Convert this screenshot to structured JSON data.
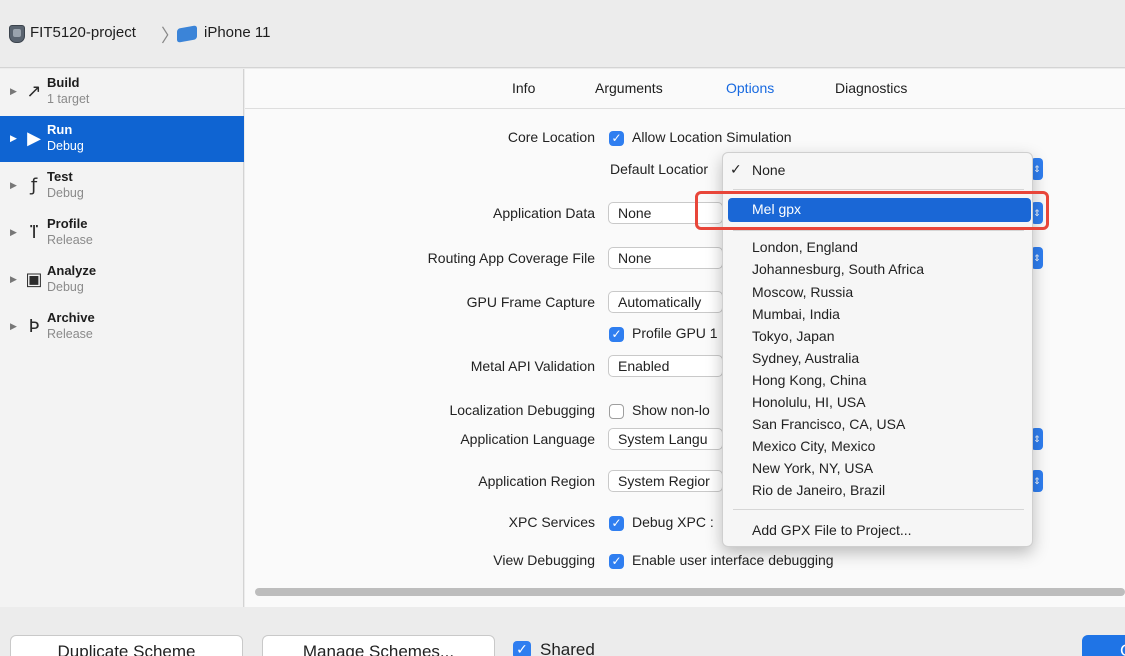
{
  "breadcrumb": {
    "project": "FIT5120-project",
    "separator": "〉",
    "device": "iPhone 11"
  },
  "sidebar": {
    "items": [
      {
        "name": "Build",
        "sub": "1 target",
        "icon": "hammer-icon",
        "glyph": "↗"
      },
      {
        "name": "Run",
        "sub": "Debug",
        "icon": "play-icon",
        "glyph": "▶"
      },
      {
        "name": "Test",
        "sub": "Debug",
        "icon": "wrench-icon",
        "glyph": "ƒ"
      },
      {
        "name": "Profile",
        "sub": "Release",
        "icon": "instruments-icon",
        "glyph": "ⴶ"
      },
      {
        "name": "Analyze",
        "sub": "Debug",
        "icon": "analyze-icon",
        "glyph": "▣"
      },
      {
        "name": "Archive",
        "sub": "Release",
        "icon": "archive-icon",
        "glyph": "Ϸ"
      }
    ],
    "selected_index": 1
  },
  "tabs": [
    "Info",
    "Arguments",
    "Options",
    "Diagnostics"
  ],
  "active_tab": "Options",
  "options": {
    "core_location": {
      "label": "Core Location",
      "checkbox": "Allow Location Simulation",
      "checked": true
    },
    "default_location": {
      "label": "Default Locatior"
    },
    "application_data": {
      "label": "Application Data",
      "value": "None"
    },
    "routing_file": {
      "label": "Routing App Coverage File",
      "value": "None"
    },
    "gpu_capture": {
      "label": "GPU Frame Capture",
      "value": "Automatically",
      "checkbox": "Profile GPU 1",
      "checked": true
    },
    "metal_validation": {
      "label": "Metal API Validation",
      "value": "Enabled"
    },
    "localization": {
      "label": "Localization Debugging",
      "checkbox": "Show non-lo",
      "checked": false
    },
    "app_language": {
      "label": "Application Language",
      "value": "System Langu"
    },
    "app_region": {
      "label": "Application Region",
      "value": "System Regior"
    },
    "xpc_services": {
      "label": "XPC Services",
      "checkbox": "Debug XPC :",
      "checked": true
    },
    "view_debugging": {
      "label": "View Debugging",
      "checkbox": "Enable user interface debugging",
      "checked": true
    }
  },
  "menu": {
    "checkmark": "✓",
    "none": "None",
    "highlighted": "Mel gpx",
    "locations": [
      "London, England",
      "Johannesburg, South Africa",
      "Moscow, Russia",
      "Mumbai, India",
      "Tokyo, Japan",
      "Sydney, Australia",
      "Hong Kong, China",
      "Honolulu, HI, USA",
      "San Francisco, CA, USA",
      "Mexico City, Mexico",
      "New York, NY, USA",
      "Rio de Janeiro, Brazil"
    ],
    "add_gpx": "Add GPX File to Project..."
  },
  "bottom": {
    "duplicate": "Duplicate Scheme",
    "manage": "Manage Schemes...",
    "shared": "Shared",
    "shared_checked": true,
    "close": "C"
  },
  "colors": {
    "accent": "#1769e0",
    "selection": "#0f64d2",
    "highlight_box": "#e8463a"
  }
}
